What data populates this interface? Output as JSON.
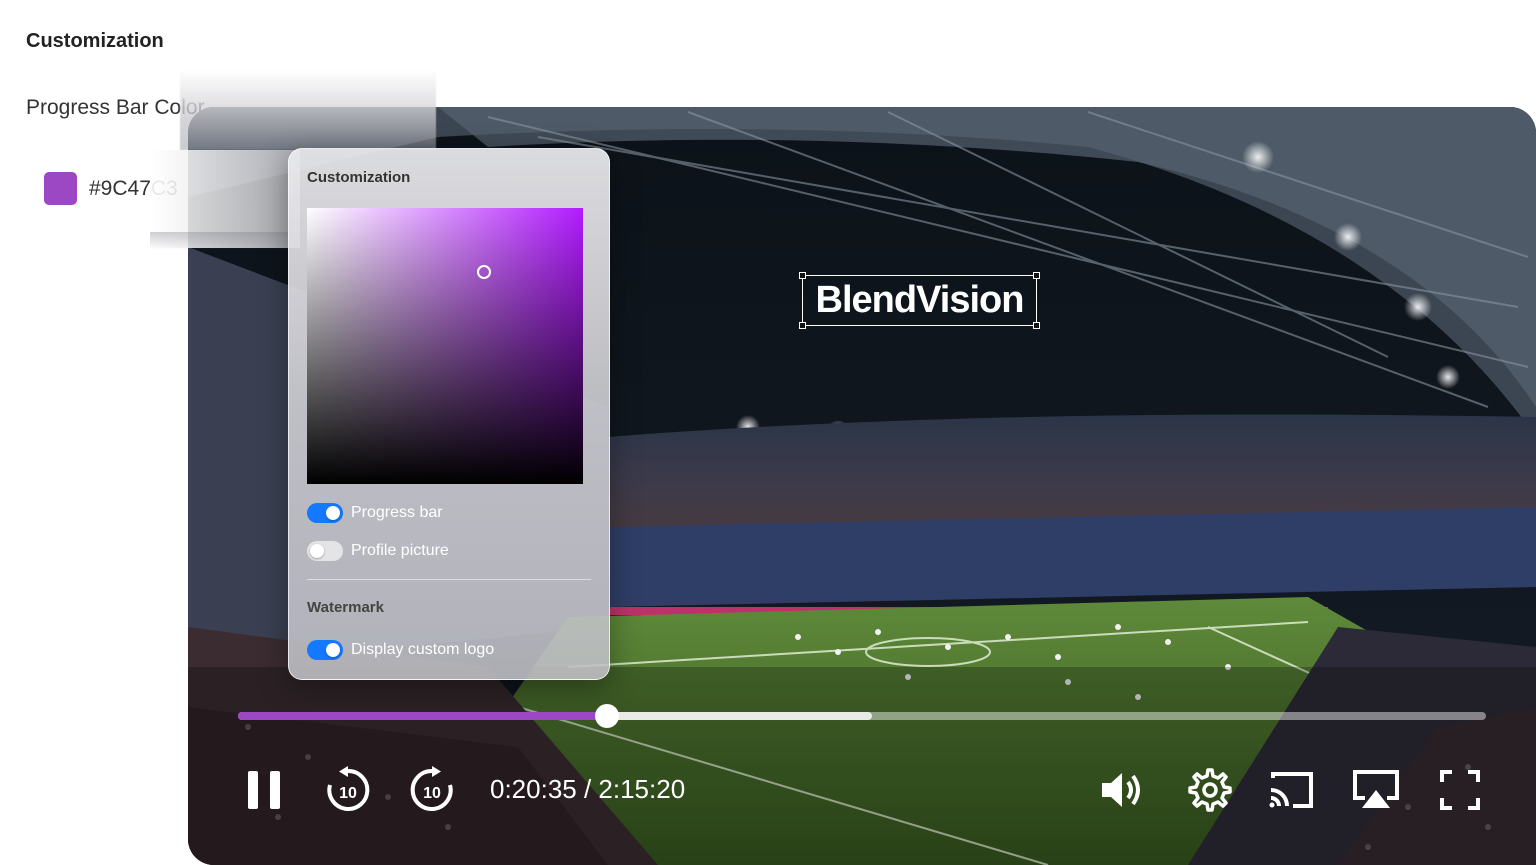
{
  "page": {
    "heading": "Customization",
    "progress_bar_color_label": "Progress Bar Color",
    "progress_bar_color_hex": "#9C47C3"
  },
  "panel": {
    "title": "Customization",
    "picker_hue": "#B21BFF",
    "toggles": [
      {
        "label": "Progress bar",
        "on": true
      },
      {
        "label": "Profile picture",
        "on": false
      }
    ],
    "watermark_section": "Watermark",
    "watermark_toggle": {
      "label": "Display custom logo",
      "on": true
    }
  },
  "video": {
    "watermark_logo_text": "BlendVision",
    "progress_played_fraction": 0.296,
    "progress_buffered_fraction": 0.508,
    "progress_color": "#9C47C3",
    "time_display": "0:20:35 / 2:15:20",
    "icons": [
      "pause-icon",
      "rewind-10-icon",
      "forward-10-icon",
      "volume-icon",
      "settings-icon",
      "cast-icon",
      "airplay-icon",
      "fullscreen-icon"
    ],
    "skip_seconds": "10"
  }
}
